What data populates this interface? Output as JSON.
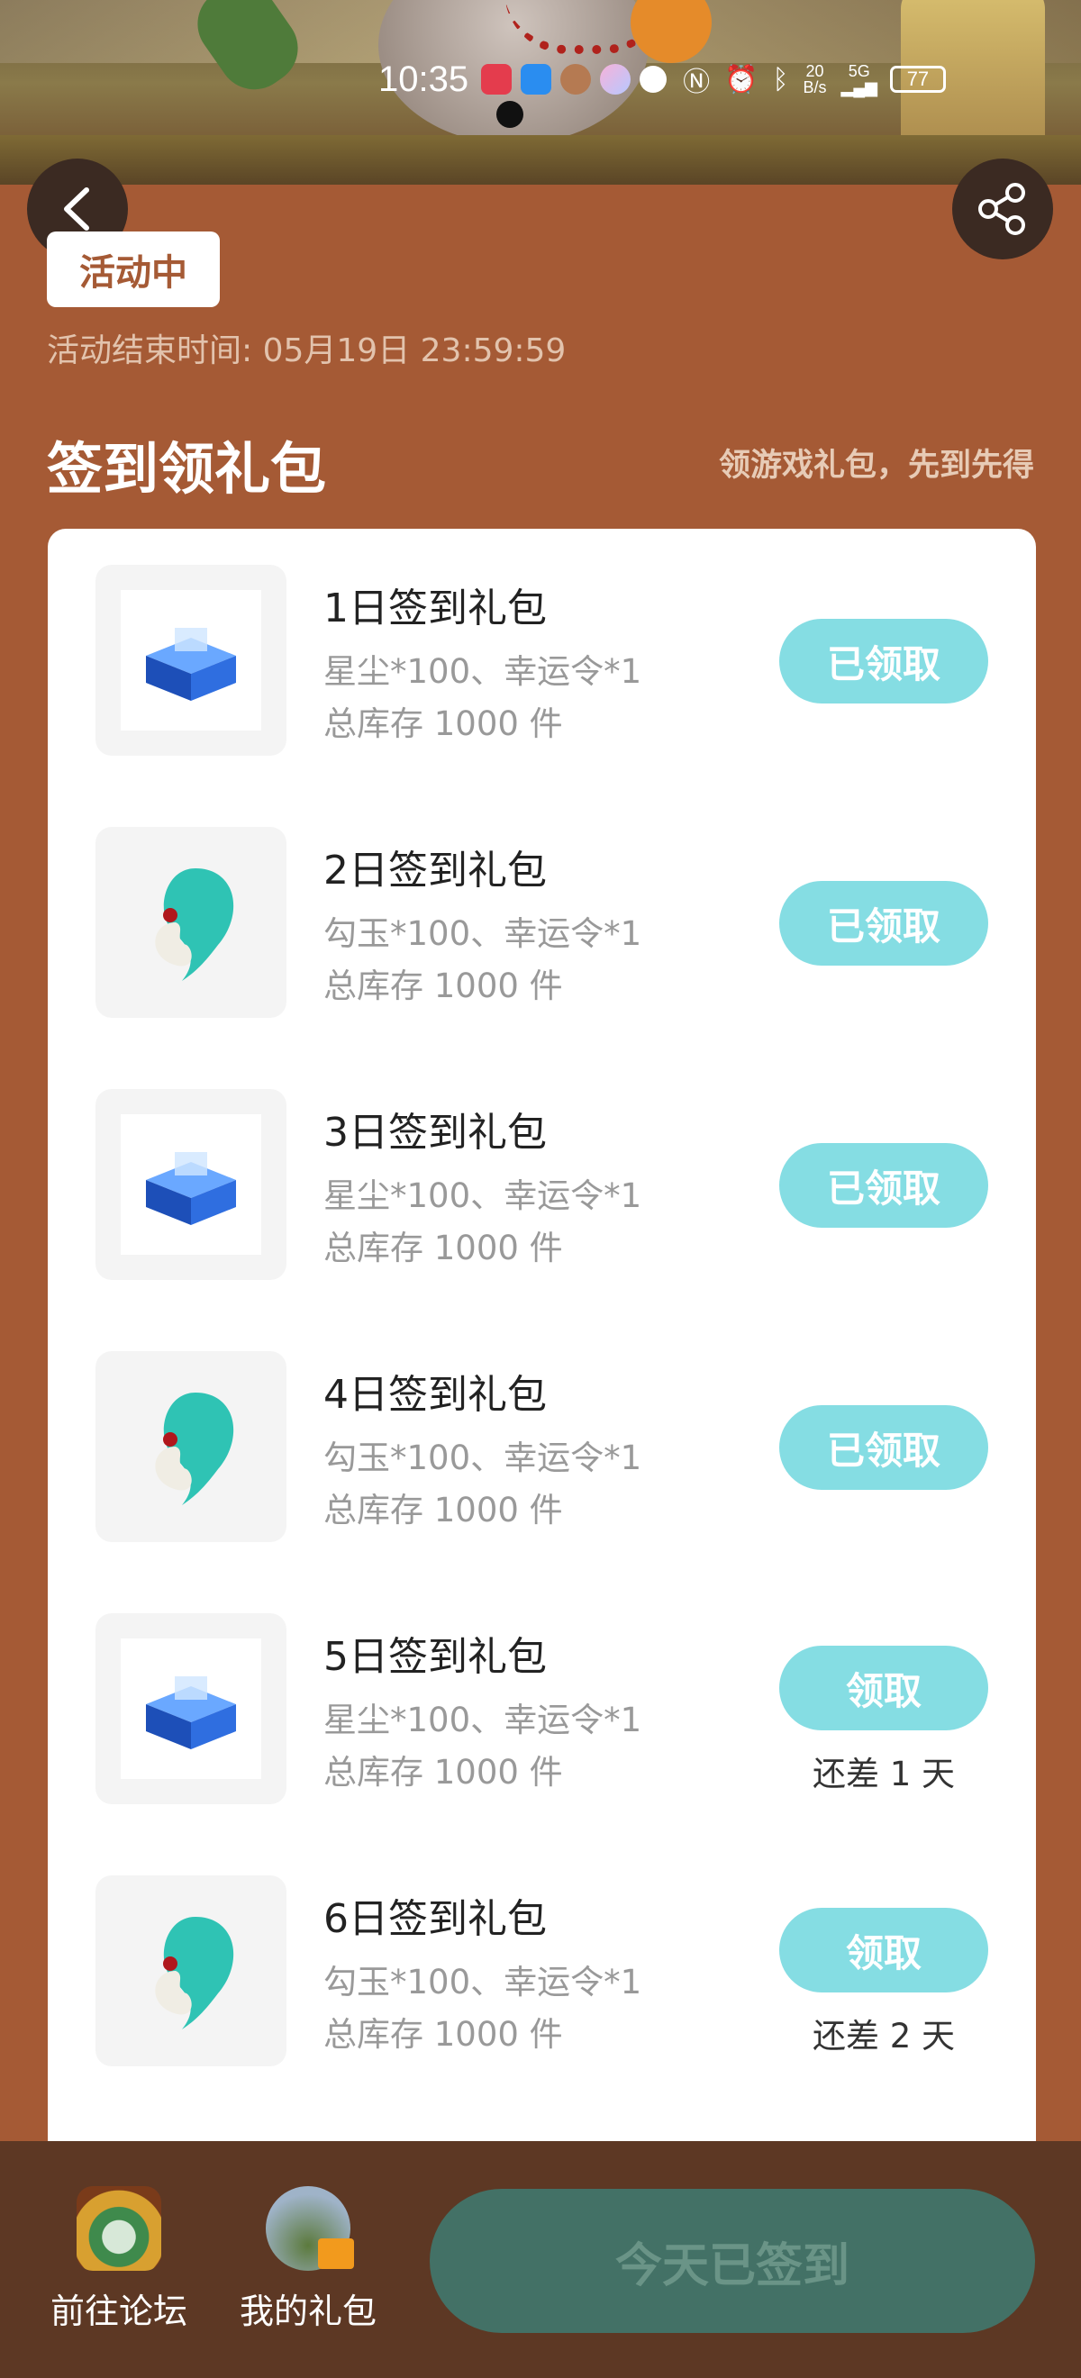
{
  "status_bar": {
    "time": "10:35",
    "net_speed_value": "20",
    "net_speed_unit": "B/s",
    "signal": "5G",
    "battery": "77"
  },
  "header": {
    "badge": "活动中",
    "end_time": "活动结束时间: 05月19日 23:59:59"
  },
  "section": {
    "title": "签到领礼包",
    "subtitle": "领游戏礼包，先到先得"
  },
  "gifts": [
    {
      "name": "1日签到礼包",
      "desc": "星尘*100、幸运令*1",
      "stock": "总库存 1000 件",
      "button": "已领取",
      "remain": "",
      "icon": "star-dust-chest-icon"
    },
    {
      "name": "2日签到礼包",
      "desc": "勾玉*100、幸运令*1",
      "stock": "总库存 1000 件",
      "button": "已领取",
      "remain": "",
      "icon": "jade-magatama-icon"
    },
    {
      "name": "3日签到礼包",
      "desc": "星尘*100、幸运令*1",
      "stock": "总库存 1000 件",
      "button": "已领取",
      "remain": "",
      "icon": "star-dust-chest-icon"
    },
    {
      "name": "4日签到礼包",
      "desc": "勾玉*100、幸运令*1",
      "stock": "总库存 1000 件",
      "button": "已领取",
      "remain": "",
      "icon": "jade-magatama-icon"
    },
    {
      "name": "5日签到礼包",
      "desc": "星尘*100、幸运令*1",
      "stock": "总库存 1000 件",
      "button": "领取",
      "remain": "还差 1 天",
      "icon": "star-dust-chest-icon"
    },
    {
      "name": "6日签到礼包",
      "desc": "勾玉*100、幸运令*1",
      "stock": "总库存 1000 件",
      "button": "领取",
      "remain": "还差 2 天",
      "icon": "jade-magatama-icon"
    }
  ],
  "bottom": {
    "forum_label": "前往论坛",
    "gifts_label": "我的礼包",
    "sign_button": "今天已签到"
  },
  "colors": {
    "background": "#a55a35",
    "button": "#85dde3",
    "bottom_bar": "#5d3824",
    "sign_button": "#437166"
  }
}
